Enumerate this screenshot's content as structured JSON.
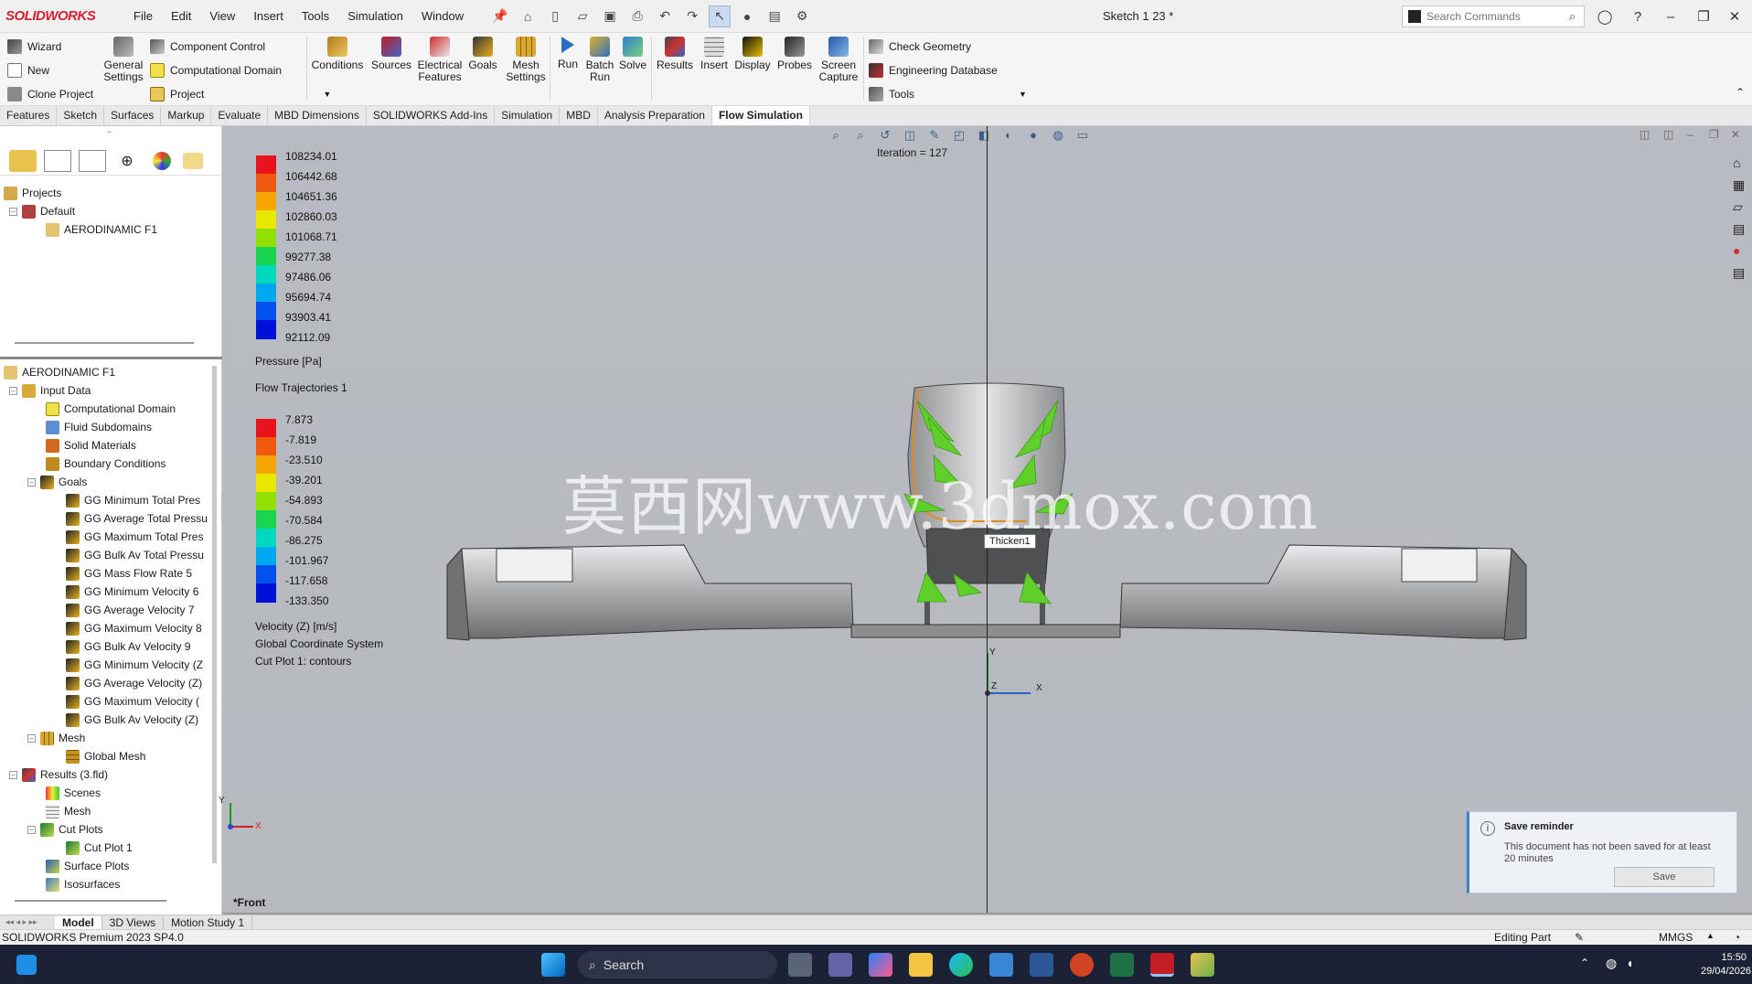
{
  "app": {
    "brand": "SOLIDWORKS",
    "doc_title": "Sketch 1 23 *",
    "menu": [
      "File",
      "Edit",
      "View",
      "Insert",
      "Tools",
      "Simulation",
      "Window"
    ],
    "search_placeholder": "Search Commands"
  },
  "ribbon": {
    "left_small": [
      {
        "label": "Wizard",
        "icon": "wand-icon"
      },
      {
        "label": "New",
        "icon": "new-doc-icon"
      },
      {
        "label": "Clone Project",
        "icon": "clone-icon"
      }
    ],
    "general_settings": "General Settings",
    "mid_small": [
      {
        "label": "Component Control",
        "icon": "component-control-icon"
      },
      {
        "label": "Computational Domain",
        "icon": "domain-icon"
      },
      {
        "label": "Project",
        "icon": "project-icon"
      }
    ],
    "big_buttons": [
      "Conditions",
      "Sources",
      "Electrical Features",
      "Goals",
      "Mesh Settings",
      "Run",
      "Batch Run",
      "Solve",
      "Results",
      "Insert",
      "Display",
      "Probes",
      "Screen Capture"
    ],
    "right_small": [
      {
        "label": "Check Geometry",
        "icon": "check-geometry-icon"
      },
      {
        "label": "Engineering Database",
        "icon": "database-icon"
      },
      {
        "label": "Tools",
        "icon": "tools-icon"
      }
    ]
  },
  "command_tabs": [
    "Features",
    "Sketch",
    "Surfaces",
    "Markup",
    "Evaluate",
    "MBD Dimensions",
    "SOLIDWORKS Add-Ins",
    "Simulation",
    "MBD",
    "Analysis Preparation",
    "Flow Simulation"
  ],
  "active_command_tab": "Flow Simulation",
  "projects_tree": {
    "root": "Projects",
    "config": "Default",
    "project": "AERODINAMIC F1"
  },
  "analysis_tree": {
    "root": "AERODINAMIC F1",
    "input_data": "Input Data",
    "input_children": [
      "Computational Domain",
      "Fluid Subdomains",
      "Solid Materials",
      "Boundary Conditions"
    ],
    "goals_label": "Goals",
    "goals": [
      "GG Minimum Total Pres",
      "GG Average Total Pressu",
      "GG Maximum Total Pres",
      "GG Bulk Av Total Pressu",
      "GG Mass Flow Rate 5",
      "GG Minimum Velocity 6",
      "GG Average Velocity 7",
      "GG Maximum Velocity 8",
      "GG Bulk Av Velocity 9",
      "GG Minimum Velocity (Z",
      "GG Average Velocity (Z)",
      "GG Maximum Velocity (",
      "GG Bulk Av Velocity (Z) "
    ],
    "mesh_label": "Mesh",
    "global_mesh": "Global Mesh",
    "results_label": "Results (3.fld)",
    "scenes": "Scenes",
    "results_mesh": "Mesh",
    "cut_plots": "Cut Plots",
    "cut_plot_1": "Cut Plot 1",
    "surface_plots": "Surface Plots",
    "isosurfaces": "Isosurfaces"
  },
  "viewport": {
    "iteration": "Iteration = 127",
    "pressure_values": [
      "108234.01",
      "106442.68",
      "104651.36",
      "102860.03",
      "101068.71",
      "99277.38",
      "97486.06",
      "95694.74",
      "93903.41",
      "92112.09"
    ],
    "pressure_title": "Pressure [Pa]",
    "trajectories_title": "Flow Trajectories 1",
    "velocity_values": [
      "7.873",
      "-7.819",
      "-23.510",
      "-39.201",
      "-54.893",
      "-70.584",
      "-86.275",
      "-101.967",
      "-117.658",
      "-133.350"
    ],
    "velocity_title": "Velocity (Z) [m/s]",
    "coord_system": "Global Coordinate System",
    "cut_plot_info": "Cut Plot 1: contours",
    "tooltip": "Thicken1",
    "watermark": "莫西网www.3dmox.com",
    "view_label": "*Front",
    "axis_x": "X",
    "axis_y": "Y",
    "axis_z": "Z",
    "legend_colors": [
      "#e8141c",
      "#f05a10",
      "#f5a500",
      "#e9e600",
      "#8fe000",
      "#19d450",
      "#00d8c0",
      "#00a8f0",
      "#0050f0",
      "#0010d8"
    ]
  },
  "save_reminder": {
    "title": "Save reminder",
    "message": "This document has not been saved for at least 20 minutes",
    "button": "Save"
  },
  "bottom_tabs": [
    "Model",
    "3D Views",
    "Motion Study 1"
  ],
  "status": {
    "product": "SOLIDWORKS Premium 2023 SP4.0",
    "mode": "Editing Part",
    "units": "MMGS"
  },
  "taskbar": {
    "search": "Search",
    "time": "15:50",
    "date": "29/04/2026"
  }
}
